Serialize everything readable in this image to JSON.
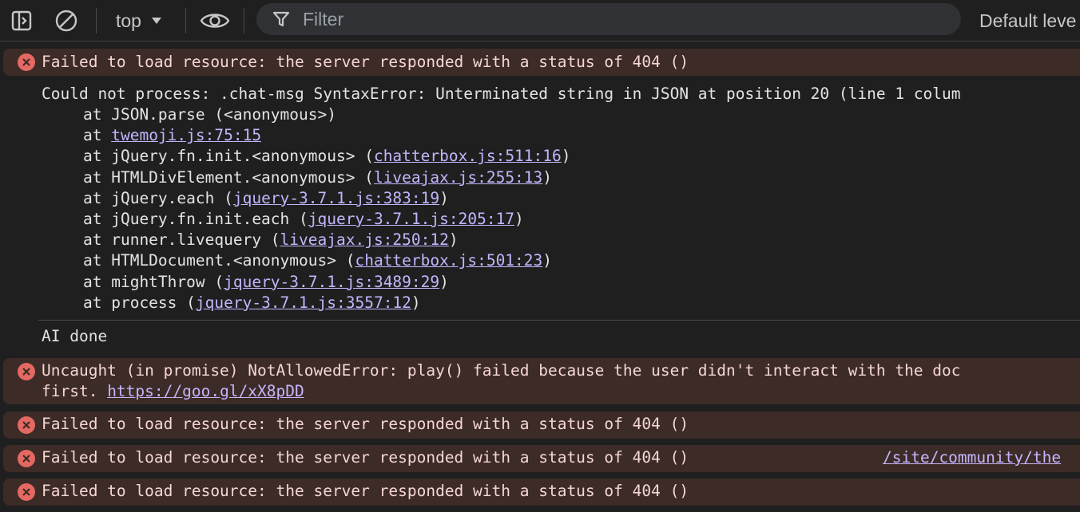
{
  "toolbar": {
    "context": "top",
    "filter_placeholder": "Filter",
    "levels_label": "Default leve"
  },
  "console": {
    "msg1": "Failed to load resource: the server responded with a status of 404 ()",
    "trace_header": "Could not process: .chat-msg SyntaxError: Unterminated string in JSON at position 20 (line 1 colum",
    "trace": [
      {
        "pre": "at JSON.parse (<anonymous>)",
        "link": "",
        "post": ""
      },
      {
        "pre": "at ",
        "link": "twemoji.js:75:15",
        "post": ""
      },
      {
        "pre": "at jQuery.fn.init.<anonymous> (",
        "link": "chatterbox.js:511:16",
        "post": ")"
      },
      {
        "pre": "at HTMLDivElement.<anonymous> (",
        "link": "liveajax.js:255:13",
        "post": ")"
      },
      {
        "pre": "at jQuery.each (",
        "link": "jquery-3.7.1.js:383:19",
        "post": ")"
      },
      {
        "pre": "at jQuery.fn.init.each (",
        "link": "jquery-3.7.1.js:205:17",
        "post": ")"
      },
      {
        "pre": "at runner.livequery (",
        "link": "liveajax.js:250:12",
        "post": ")"
      },
      {
        "pre": "at HTMLDocument.<anonymous> (",
        "link": "chatterbox.js:501:23",
        "post": ")"
      },
      {
        "pre": "at mightThrow (",
        "link": "jquery-3.7.1.js:3489:29",
        "post": ")"
      },
      {
        "pre": "at process (",
        "link": "jquery-3.7.1.js:3557:12",
        "post": ")"
      }
    ],
    "ai_done": "AI done",
    "promise_line1": "Uncaught (in promise) NotAllowedError: play() failed because the user didn't interact with the doc",
    "promise_line2_pre": "first. ",
    "promise_link": "https://goo.gl/xX8pDD",
    "msg4": "Failed to load resource: the server responded with a status of 404 ()",
    "msg5": "Failed to load resource: the server responded with a status of 404 ()",
    "msg5_source": "/site/community/the",
    "msg6": "Failed to load resource: the server responded with a status of 404 ()"
  },
  "colors": {
    "error_bg": "#3c2b26",
    "error_icon": "#e46962",
    "link": "#c4b5fd"
  }
}
